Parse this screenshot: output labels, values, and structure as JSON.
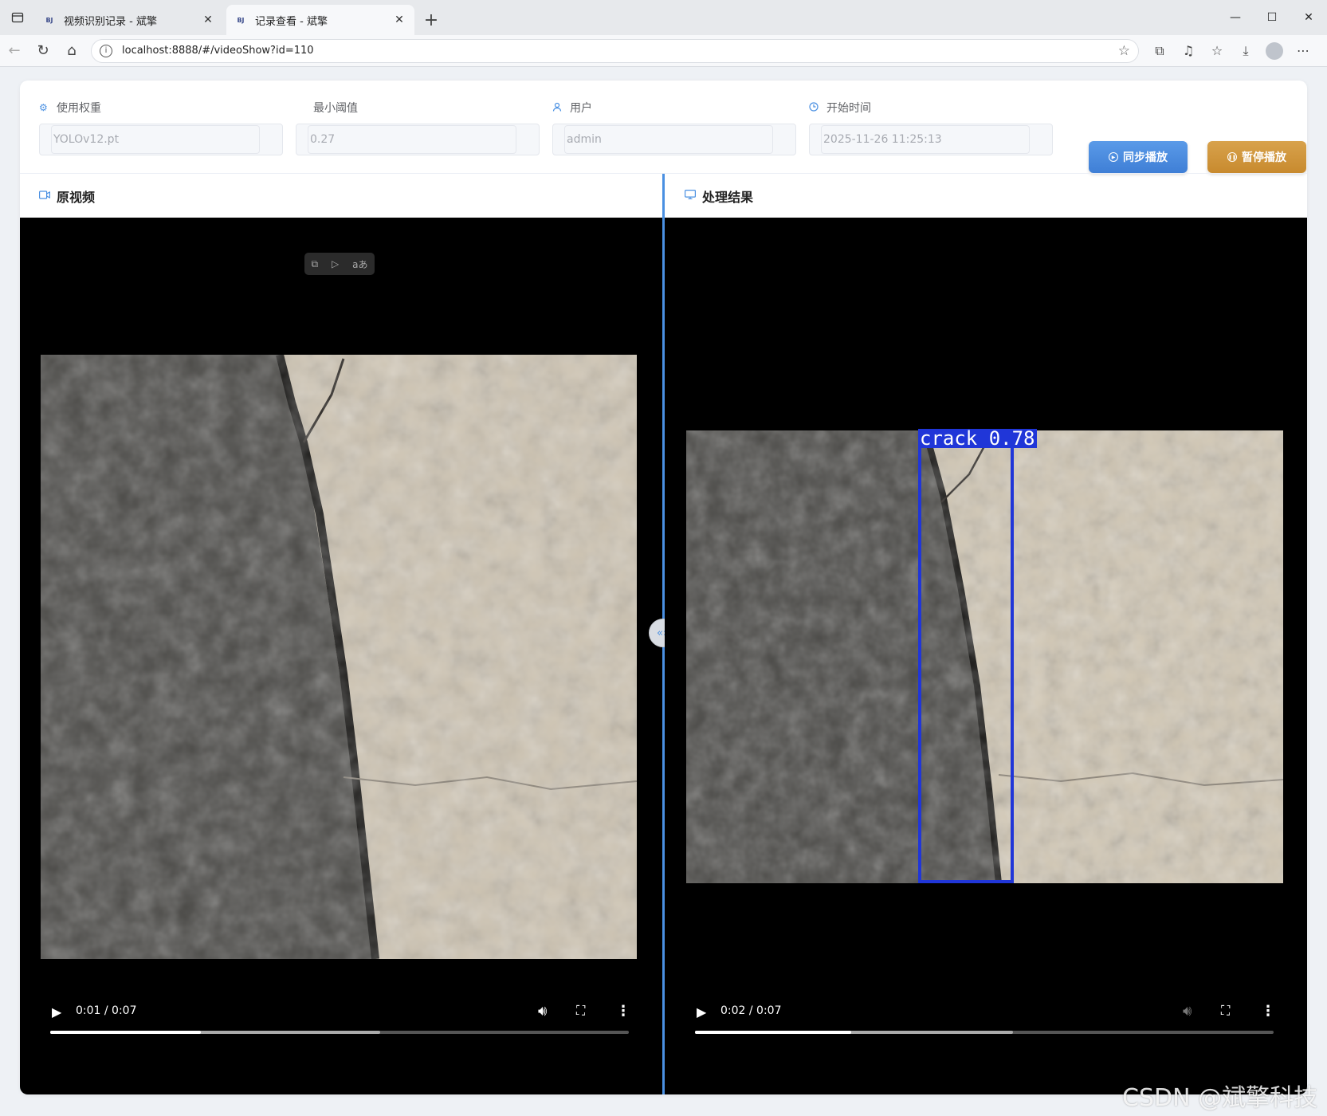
{
  "browser": {
    "tabs": [
      {
        "favicon": "BJ",
        "title": "视频识别记录 - 斌擎",
        "active": false
      },
      {
        "favicon": "BJ",
        "title": "记录查看 - 斌擎",
        "active": true
      }
    ],
    "url": "localhost:8888/#/videoShow?id=110",
    "icons": {
      "sidebar": "sidebar-toggle-icon",
      "close": "close-icon",
      "new_tab": "plus-icon",
      "back": "back-arrow-icon",
      "reload": "reload-icon",
      "home": "home-icon",
      "info": "info-icon",
      "star": "star-icon",
      "extensions": "puzzle-icon",
      "favorites": "favorites-icon",
      "download": "download-icon",
      "more": "ellipsis-icon"
    }
  },
  "form": {
    "weight": {
      "label": "使用权重",
      "value": "YOLOv12.pt"
    },
    "threshold": {
      "label": "最小阈值",
      "value": "0.27"
    },
    "user": {
      "label": "用户",
      "value": "admin"
    },
    "start_time": {
      "label": "开始时间",
      "value": "2025-11-26 11:25:13"
    }
  },
  "buttons": {
    "sync": "同步播放",
    "pause": "暂停播放"
  },
  "panels": {
    "original": {
      "title": "原视频",
      "player": {
        "current": "0:01",
        "duration": "0:07",
        "time_text": "0:01 / 0:07",
        "progress": 0.26,
        "buffered": 0.57,
        "muted": false
      }
    },
    "result": {
      "title": "处理结果",
      "player": {
        "current": "0:02",
        "duration": "0:07",
        "time_text": "0:02 / 0:07",
        "progress": 0.27,
        "buffered": 0.55,
        "muted": true
      },
      "detection": {
        "label": "crack 0.78",
        "class": "crack",
        "confidence": 0.78,
        "color": "#2036d8"
      }
    }
  },
  "watermark": "CSDN @斌擎科技",
  "colors": {
    "accent": "#4a90e2",
    "sync_button": "#4a8ee0",
    "pause_button": "#d09838"
  }
}
